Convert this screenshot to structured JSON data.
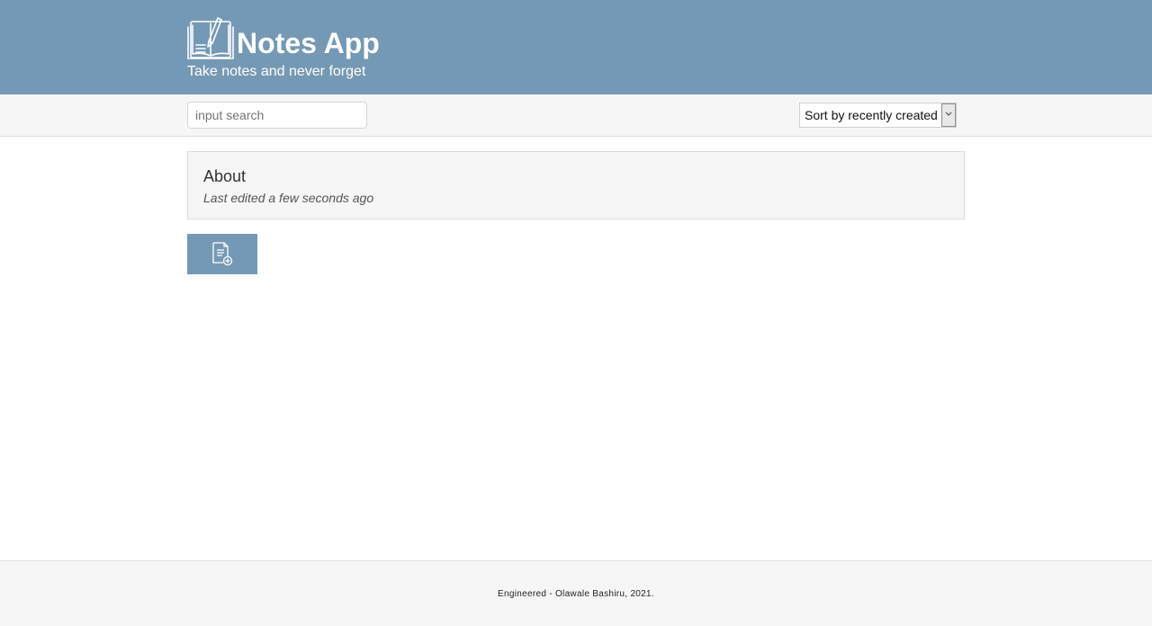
{
  "header": {
    "title": "Notes App",
    "subtitle": "Take notes and never forget",
    "logo_icon": "notebook-pen-icon",
    "background_color": "#7599b4"
  },
  "toolbar": {
    "search": {
      "value": "",
      "placeholder": "input search"
    },
    "sort": {
      "selected": "Sort by recently created",
      "arrow_icon": "chevron-down-icon"
    }
  },
  "notes": [
    {
      "title": "About",
      "meta": "Last edited a few seconds ago"
    }
  ],
  "add_note_button": {
    "icon": "document-add-icon",
    "color": "#7599b4"
  },
  "footer": {
    "text": "Engineered - Olawale Bashiru, 2021."
  }
}
